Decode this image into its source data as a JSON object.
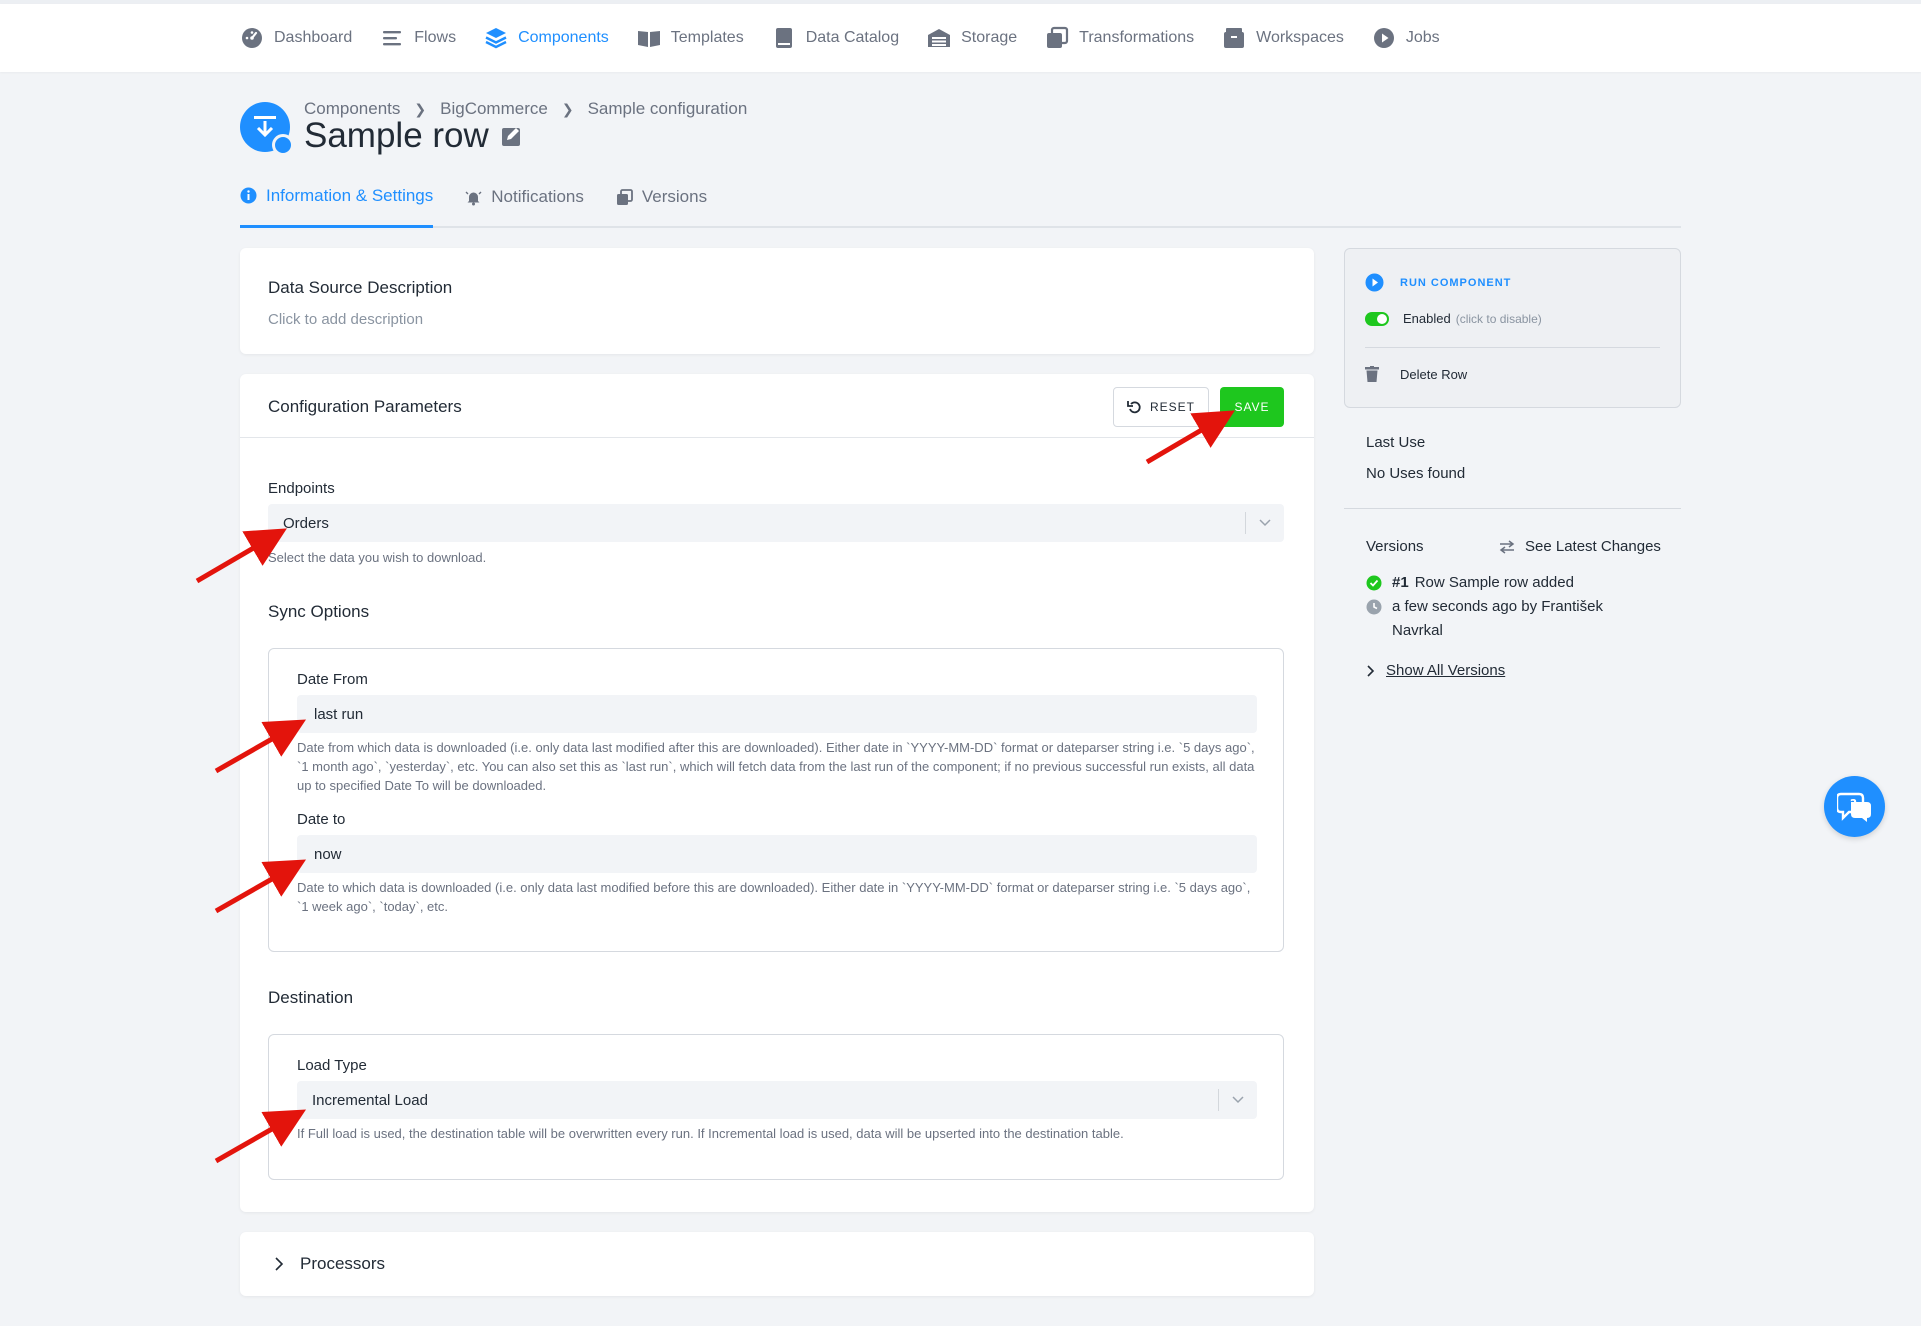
{
  "nav": {
    "items": [
      {
        "label": "Dashboard"
      },
      {
        "label": "Flows"
      },
      {
        "label": "Components"
      },
      {
        "label": "Templates"
      },
      {
        "label": "Data Catalog"
      },
      {
        "label": "Storage"
      },
      {
        "label": "Transformations"
      },
      {
        "label": "Workspaces"
      },
      {
        "label": "Jobs"
      }
    ],
    "active": "Components"
  },
  "breadcrumb": [
    "Components",
    "BigCommerce",
    "Sample configuration"
  ],
  "page_title": "Sample row",
  "tabs": [
    {
      "label": "Information & Settings"
    },
    {
      "label": "Notifications"
    },
    {
      "label": "Versions"
    }
  ],
  "description": {
    "title": "Data Source Description",
    "placeholder": "Click to add description"
  },
  "config": {
    "title": "Configuration Parameters",
    "reset_label": "RESET",
    "save_label": "SAVE",
    "endpoints": {
      "label": "Endpoints",
      "value": "Orders",
      "help": "Select the data you wish to download."
    },
    "sync_options": {
      "title": "Sync Options",
      "date_from": {
        "label": "Date From",
        "value": "last run",
        "help": "Date from which data is downloaded (i.e. only data last modified after this are downloaded). Either date in `YYYY-MM-DD` format or dateparser string i.e. `5 days ago`, `1 month ago`, `yesterday`, etc. You can also set this as `last run`, which will fetch data from the last run of the component; if no previous successful run exists, all data up to specified Date To will be downloaded."
      },
      "date_to": {
        "label": "Date to",
        "value": "now",
        "help": "Date to which data is downloaded (i.e. only data last modified before this are downloaded). Either date in `YYYY-MM-DD` format or dateparser string i.e. `5 days ago`, `1 week ago`, `today`, etc."
      }
    },
    "destination": {
      "title": "Destination",
      "load_type": {
        "label": "Load Type",
        "value": "Incremental Load",
        "help": "If Full load is used, the destination table will be overwritten every run. If Incremental load is used, data will be upserted into the destination table."
      }
    }
  },
  "processors": {
    "label": "Processors"
  },
  "side": {
    "run_label": "RUN COMPONENT",
    "enabled_label": "Enabled",
    "enabled_hint": "(click to disable)",
    "delete_label": "Delete Row",
    "last_use_title": "Last Use",
    "last_use_value": "No Uses found",
    "versions_title": "Versions",
    "see_changes": "See Latest Changes",
    "version_number": "#1",
    "version_desc": "Row Sample row added",
    "version_time_1": "a few seconds ago by František",
    "version_time_2": "Navrkal",
    "show_all": "Show All Versions"
  },
  "colors": {
    "accent": "#1f8fff",
    "save": "#1ec71e",
    "annotation": "#e3140c"
  }
}
